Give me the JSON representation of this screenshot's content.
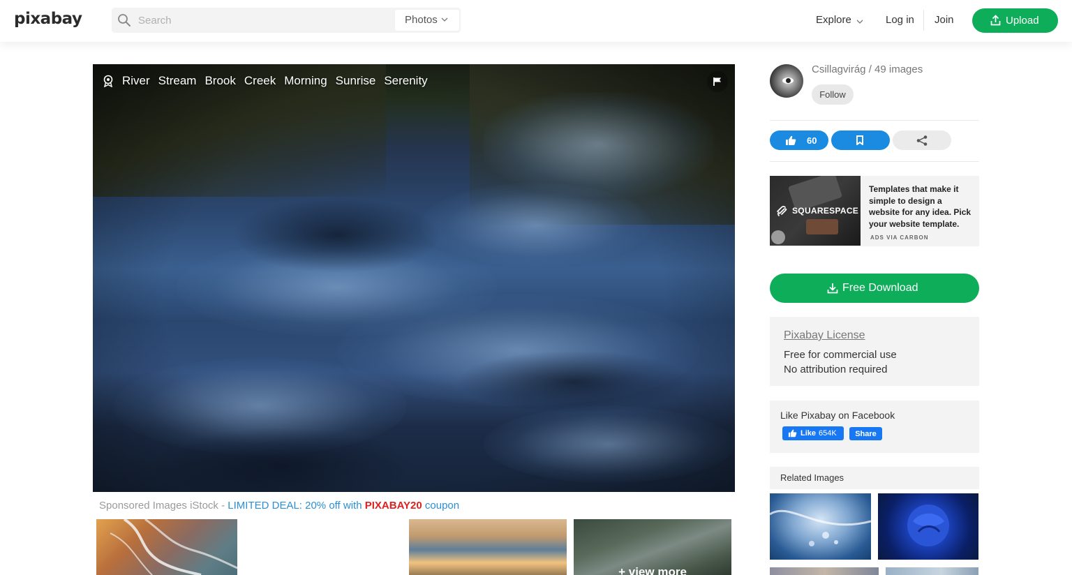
{
  "header": {
    "logo": "pixabay",
    "search_placeholder": "Search",
    "search_type": "Photos",
    "nav": {
      "explore": "Explore",
      "login": "Log in",
      "join": "Join",
      "upload": "Upload"
    }
  },
  "photo": {
    "tags": [
      "River",
      "Stream",
      "Brook",
      "Creek",
      "Morning",
      "Sunrise",
      "Serenity"
    ]
  },
  "sponsored": {
    "prefix": "Sponsored Images iStock - ",
    "deal": "LIMITED DEAL: 20% off with ",
    "code": "PIXABAY20",
    "suffix": " coupon",
    "view_more": "+ view more"
  },
  "sidebar": {
    "user": "Csillagvirág / 49 images",
    "follow": "Follow",
    "likes": "60",
    "ad": {
      "brand": "SQUARESPACE",
      "text": "Templates that make it simple to design a website for any idea. Pick your website template.",
      "via": "ADS VIA CARBON"
    },
    "download": "Free Download",
    "license": {
      "title": "Pixabay License",
      "line1": "Free for commercial use",
      "line2": "No attribution required"
    },
    "facebook": {
      "title": "Like Pixabay on Facebook",
      "like": "Like",
      "count": "654K",
      "share": "Share"
    },
    "related_title": "Related Images"
  },
  "colors": {
    "accent_green": "#0ead5a",
    "accent_blue": "#1a8be0",
    "deal_blue": "#2a8fd6",
    "code_red": "#e02020"
  },
  "icons": [
    "search-icon",
    "chevron-down-icon",
    "upload-icon",
    "tag-award-icon",
    "flag-icon",
    "thumbs-up-icon",
    "bookmark-icon",
    "share-icon",
    "download-icon",
    "facebook-thumb-icon",
    "squarespace-logo-icon"
  ]
}
